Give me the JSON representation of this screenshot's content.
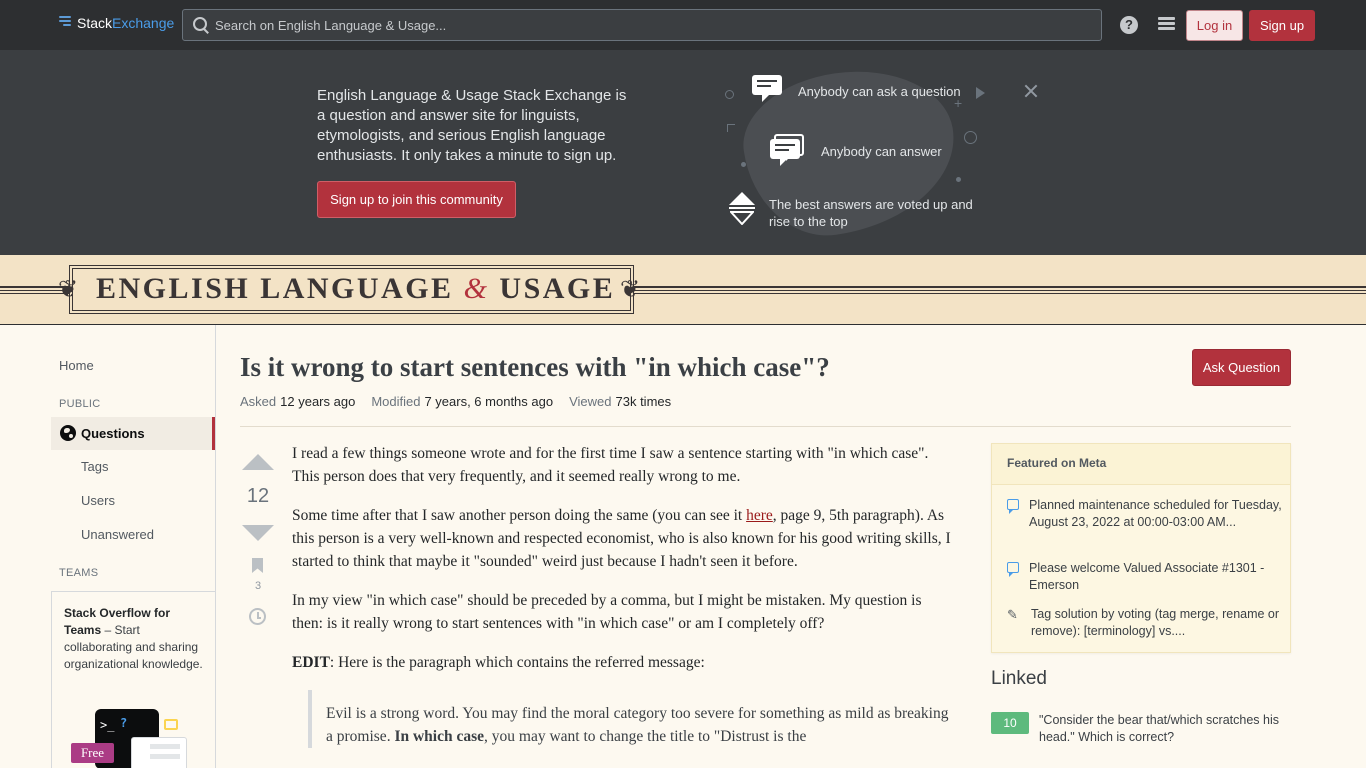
{
  "topbar": {
    "logo_part1": "Stack",
    "logo_part2": "Exchange",
    "search_placeholder": "Search on English Language & Usage...",
    "help_icon": "?",
    "login_label": "Log in",
    "signup_label": "Sign up"
  },
  "hero": {
    "text": "English Language & Usage Stack Exchange is a question and answer site for linguists, etymologists, and serious English language enthusiasts. It only takes a minute to sign up.",
    "cta_label": "Sign up to join this community",
    "features": [
      "Anybody can ask a question",
      "Anybody can answer",
      "The best answers are voted up and rise to the top"
    ]
  },
  "banner": {
    "title_left": "ENGLISH LANGUAGE",
    "title_amp": "&",
    "title_right": "USAGE",
    "ornament": "❦"
  },
  "leftnav": {
    "home": "Home",
    "public_heading": "PUBLIC",
    "questions": "Questions",
    "tags": "Tags",
    "users": "Users",
    "unanswered": "Unanswered",
    "teams_heading": "TEAMS",
    "teams_title": "Stack Overflow for Teams",
    "teams_text": " – Start collaborating and sharing organizational knowledge.",
    "teams_art_prompt": ">_",
    "teams_art_q": "?",
    "free_badge": "Free"
  },
  "question": {
    "title": "Is it wrong to start sentences with \"in which case\"?",
    "ask_button": "Ask Question",
    "meta": [
      {
        "label": "Asked",
        "value": "12 years ago"
      },
      {
        "label": "Modified",
        "value": "7 years, 6 months ago"
      },
      {
        "label": "Viewed",
        "value": "73k times"
      }
    ],
    "votes": "12",
    "bookmarks": "3",
    "body": {
      "p1": "I read a few things someone wrote and for the first time I saw a sentence starting with \"in which case\". This person does that very frequently, and it seemed really wrong to me.",
      "p2_before": "Some time after that I saw another person doing the same (you can see it ",
      "p2_link": "here",
      "p2_after": ", page 9, 5th paragraph). As this person is a very well-known and respected economist, who is also known for his good writing skills, I started to think that maybe it \"sounded\" weird just because I hadn't seen it before.",
      "p3": "In my view \"in which case\" should be preceded by a comma, but I might be mistaken. My question is then: is it really wrong to start sentences with \"in which case\" or am I completely off?",
      "p4_bold": "EDIT",
      "p4_rest": ": Here is the paragraph which contains the referred message:",
      "quote_before": "Evil is a strong word. You may find the moral category too severe for something as mild as breaking a promise. ",
      "quote_bold": "In which case",
      "quote_after": ", you may want to change the title to \"Distrust is the"
    }
  },
  "sidebar": {
    "featured_heading": "Featured on Meta",
    "featured": [
      {
        "icon": "chat",
        "text": "Planned maintenance scheduled for Tuesday, August 23, 2022 at 00:00-03:00 AM..."
      },
      {
        "icon": "chat",
        "text": "Please welcome Valued Associate #1301 - Emerson"
      },
      {
        "icon": "pen",
        "text": "Tag solution by voting (tag merge, rename or remove): [terminology] vs...."
      }
    ],
    "linked_heading": "Linked",
    "linked": [
      {
        "score": "10",
        "text": "\"Consider the bear that/which scratches his head.\" Which is correct?"
      }
    ]
  },
  "colors": {
    "topbar_bg": "#2d2f31",
    "hero_bg": "#3b3e41",
    "accent": "#b2323d",
    "banner_bg": "#f3e3c6",
    "page_bg": "#fdf9f0",
    "linked_score": "#5eba7d"
  }
}
